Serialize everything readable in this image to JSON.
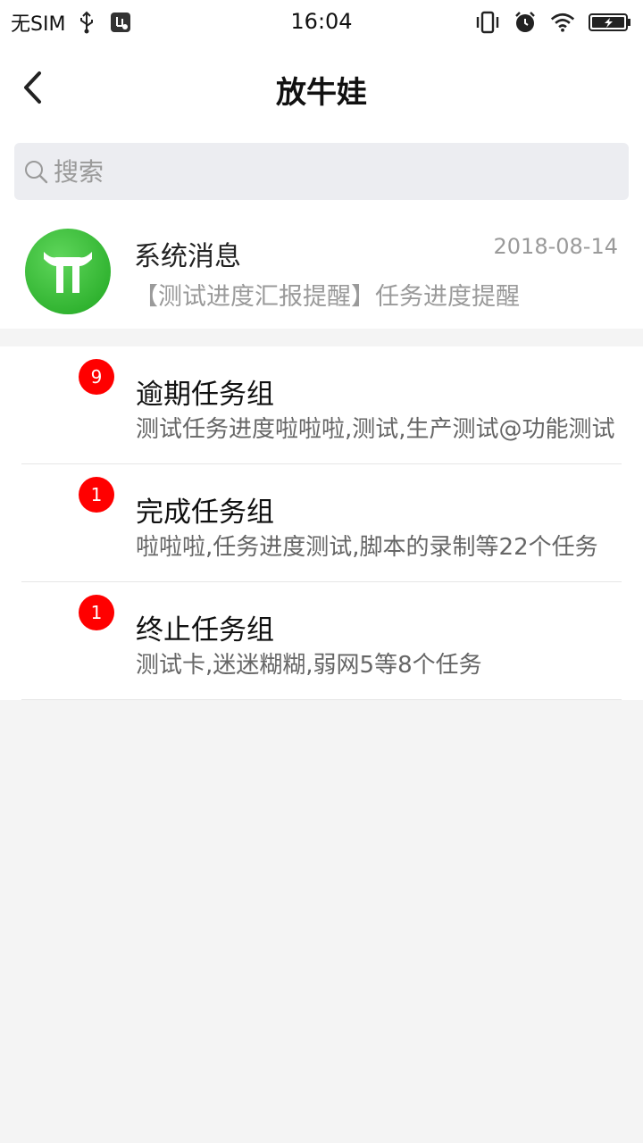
{
  "status_bar": {
    "carrier": "无SIM",
    "time": "16:04",
    "left_icons": [
      "usb-icon",
      "usb-debug-icon"
    ],
    "right_icons": [
      "vibrate-icon",
      "alarm-icon",
      "wifi-icon",
      "battery-charging-icon"
    ]
  },
  "nav": {
    "title": "放牛娃",
    "back_icon": "chevron-left-icon"
  },
  "search": {
    "placeholder": "搜索",
    "value": ""
  },
  "system_message": {
    "name": "系统消息",
    "date": "2018-08-14",
    "preview": "【测试进度汇报提醒】任务进度提醒",
    "avatar_color": "#27b026"
  },
  "groups": [
    {
      "badge": "9",
      "title": "逾期任务组",
      "subtitle": "测试任务进度啦啦啦,测试,生产测试@功能测试"
    },
    {
      "badge": "1",
      "title": "完成任务组",
      "subtitle": "啦啦啦,任务进度测试,脚本的录制等22个任务"
    },
    {
      "badge": "1",
      "title": "终止任务组",
      "subtitle": "测试卡,迷迷糊糊,弱网5等8个任务"
    }
  ],
  "colors": {
    "badge": "#ff0000",
    "background": "#f4f4f4",
    "search_bg": "#ecedf1"
  }
}
